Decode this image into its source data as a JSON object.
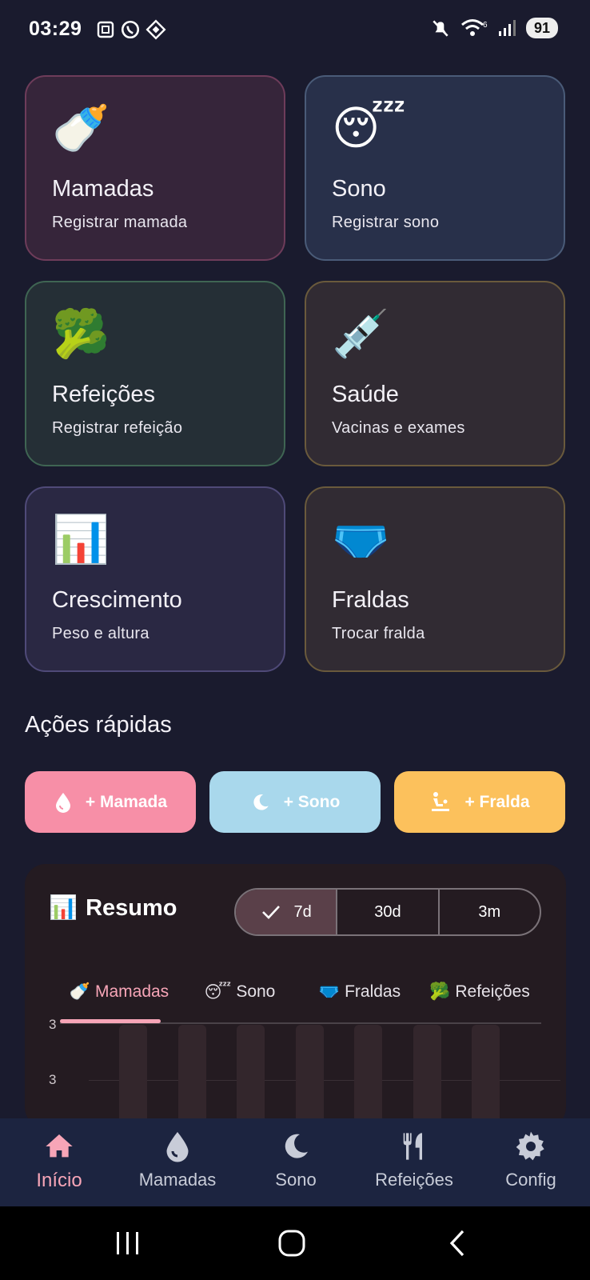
{
  "status": {
    "time": "03:29",
    "battery": "91"
  },
  "cards": [
    {
      "emoji": "🍼",
      "title": "Mamadas",
      "subtitle": "Registrar mamada"
    },
    {
      "emoji": "😴",
      "title": "Sono",
      "subtitle": "Registrar sono"
    },
    {
      "emoji": "🥦",
      "title": "Refeições",
      "subtitle": "Registrar refeição"
    },
    {
      "emoji": "💉",
      "title": "Saúde",
      "subtitle": "Vacinas e exames"
    },
    {
      "emoji": "📊",
      "title": "Crescimento",
      "subtitle": "Peso e altura"
    },
    {
      "emoji": "🩲",
      "title": "Fraldas",
      "subtitle": "Trocar fralda"
    }
  ],
  "quick_actions": {
    "title": "Ações rápidas",
    "buttons": [
      {
        "label": "+ Mamada",
        "icon": "drop-icon",
        "color": "#f78fa7"
      },
      {
        "label": "+ Sono",
        "icon": "moon-icon",
        "color": "#a9d8ec"
      },
      {
        "label": "+ Fralda",
        "icon": "baby-changing-icon",
        "color": "#fcc15c"
      }
    ]
  },
  "summary": {
    "emoji": "📊",
    "title": "Resumo",
    "periods": [
      "7d",
      "30d",
      "3m"
    ],
    "selected_period": "7d",
    "tabs": [
      {
        "emoji": "🍼",
        "label": "Mamadas"
      },
      {
        "emoji": "😴",
        "label": "Sono"
      },
      {
        "emoji": "🩲",
        "label": "Fraldas"
      },
      {
        "emoji": "🥦",
        "label": "Refeições"
      }
    ],
    "active_tab": "Mamadas"
  },
  "chart_data": {
    "type": "bar",
    "y_tick_labels": [
      "3",
      "3"
    ],
    "categories": [
      "",
      "",
      "",
      "",
      "",
      "",
      ""
    ],
    "values": [
      0,
      0,
      0,
      0,
      0,
      0,
      0.3
    ],
    "ylim": [
      0,
      3
    ]
  },
  "nav": [
    {
      "label": "Início",
      "icon": "home-icon",
      "active": true
    },
    {
      "label": "Mamadas",
      "icon": "drop-icon",
      "active": false
    },
    {
      "label": "Sono",
      "icon": "moon-icon",
      "active": false
    },
    {
      "label": "Refeições",
      "icon": "utensils-icon",
      "active": false
    },
    {
      "label": "Config",
      "icon": "gear-icon",
      "active": false
    }
  ],
  "colors": {
    "background": "#1a1b2e",
    "accent_pink": "#f7a5b7",
    "accent_blue": "#a9d8ec",
    "accent_yellow": "#fcc15c"
  }
}
